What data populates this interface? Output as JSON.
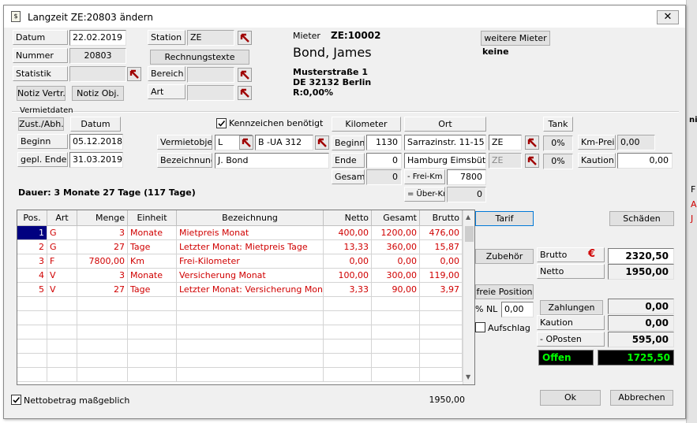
{
  "window": {
    "title": "Langzeit ZE:20803 ändern",
    "icon_text": "$"
  },
  "colors": {
    "accent": "#0078d7",
    "row_text": "#d00000",
    "offen_bg": "#000000",
    "offen_text": "#00ff00"
  },
  "bg_app": {
    "texts": [
      "A",
      "J",
      "nit",
      "F"
    ]
  },
  "top": {
    "datum_label": "Datum",
    "datum_value": "22.02.2019",
    "nummer_label": "Nummer",
    "nummer_value": "20803",
    "statistik_label": "Statistik",
    "notiz_vertr": "Notiz Vertr.",
    "notiz_obj": "Notiz Obj.",
    "station_label": "Station",
    "station_value": "ZE",
    "rechnungstexte": "Rechnungstexte",
    "bereich_label": "Bereich",
    "art_label": "Art",
    "mieter_label": "Mieter",
    "mieter_id": "ZE:10002",
    "mieter_name": "Bond, James",
    "street": "Musterstraße 1",
    "city": "DE 32132 Berlin",
    "rabatt": "R:0,00%",
    "weitere_mieter": "weitere Mieter",
    "weitere_value": "keine"
  },
  "vermiet": {
    "section": "Vermietdaten",
    "zust": "Zust./Abh.",
    "datum_header": "Datum",
    "beginn_label": "Beginn",
    "beginn_value": "05.12.2018",
    "ende_label": "gepl. Ende",
    "ende_value": "31.03.2019",
    "kennzeichen_label": "Kennzeichen benötigt",
    "kennzeichen_checked": true,
    "objekt_label": "Vermietobjekt",
    "objekt_type": "L",
    "objekt_plate": "B -UA 312",
    "bez_label": "Bezeichnung",
    "bez_value": "J. Bond",
    "km_header": "Kilometer",
    "km_beginn_label": "Beginn",
    "km_beginn": "1130",
    "km_ende_label": "Ende",
    "km_ende": "0",
    "km_gesamt_label": "Gesamt",
    "km_gesamt": "0",
    "frei_km_label": "- Frei-Km",
    "frei_km": "7800",
    "ueber_km_label": "= Über-Km",
    "ueber_km": "0",
    "ort_header": "Ort",
    "ort1": "Sarrazinstr. 11-15",
    "ort1_code": "ZE",
    "ort2": "Hamburg Eimsbüttel",
    "ort2_code": "ZE",
    "tank_header": "Tank",
    "tank1": "0%",
    "tank2": "0%",
    "kmpreis_label": "Km-Preis",
    "kmpreis": "0,00",
    "kaution_label": "Kaution",
    "kaution": "0,00",
    "dauer": "Dauer: 3 Monate 27 Tage  (117 Tage)"
  },
  "table": {
    "headers": [
      "Pos.",
      "Art",
      "Menge",
      "Einheit",
      "Bezeichnung",
      "Netto",
      "Gesamt",
      "Brutto"
    ],
    "rows": [
      {
        "pos": "1",
        "art": "G",
        "menge": "3",
        "einheit": "Monate",
        "bez": "Mietpreis Monat",
        "netto": "400,00",
        "gesamt": "1200,00",
        "brutto": "476,00"
      },
      {
        "pos": "2",
        "art": "G",
        "menge": "27",
        "einheit": "Tage",
        "bez": "Letzter Monat: Mietpreis Tage",
        "netto": "13,33",
        "gesamt": "360,00",
        "brutto": "15,87"
      },
      {
        "pos": "3",
        "art": "F",
        "menge": "7800,00",
        "einheit": "Km",
        "bez": "Frei-Kilometer",
        "netto": "0,00",
        "gesamt": "0,00",
        "brutto": "0,00"
      },
      {
        "pos": "4",
        "art": "V",
        "menge": "3",
        "einheit": "Monate",
        "bez": "Versicherung Monat",
        "netto": "100,00",
        "gesamt": "300,00",
        "brutto": "119,00"
      },
      {
        "pos": "5",
        "art": "V",
        "menge": "27",
        "einheit": "Tage",
        "bez": "Letzter Monat: Versicherung Monat",
        "netto": "3,33",
        "gesamt": "90,00",
        "brutto": "3,97"
      }
    ]
  },
  "right": {
    "tarif": "Tarif",
    "schaeden": "Schäden",
    "zubehoer": "Zubehör",
    "brutto_label": "Brutto",
    "currency": "€",
    "brutto": "2320,50",
    "netto_label": "Netto",
    "netto": "1950,00",
    "freie_position": "freie Position",
    "nl_label": "% NL",
    "nl_value": "0,00",
    "aufschlag_label": "Aufschlag",
    "zahlungen": "Zahlungen",
    "zahlungen_value": "0,00",
    "kaution_label": "Kaution",
    "kaution_value": "0,00",
    "oposten_label": "- OPosten",
    "oposten_value": "595,00",
    "offen_label": "Offen",
    "offen_value": "1725,50"
  },
  "bottom": {
    "netto_check_label": "Nettobetrag maßgeblich",
    "netto_checked": true,
    "sum": "1950,00",
    "ok": "Ok",
    "abbrechen": "Abbrechen"
  }
}
